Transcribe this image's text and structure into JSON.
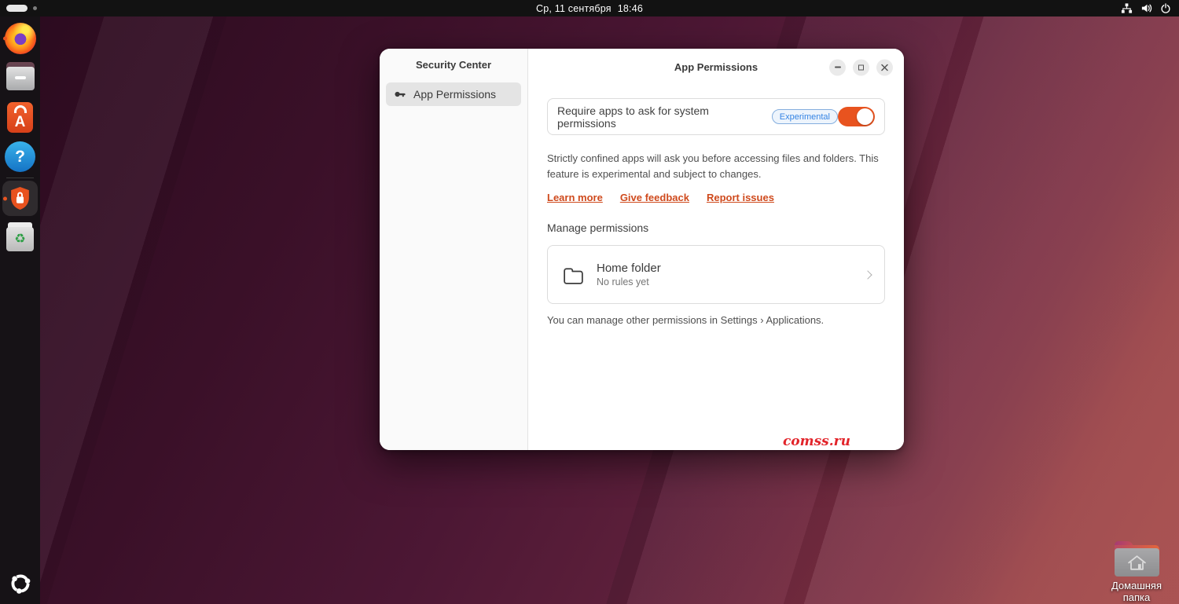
{
  "topbar": {
    "date": "Ср, 11 сентября",
    "time": "18:46",
    "status_icons": [
      "network-icon",
      "volume-icon",
      "power-icon"
    ],
    "workspace_indicator": "workspace-1-active"
  },
  "dock": {
    "items": [
      {
        "name": "firefox",
        "running": true
      },
      {
        "name": "files",
        "running": false
      },
      {
        "name": "app-center",
        "running": false
      },
      {
        "name": "help",
        "running": false
      },
      {
        "name": "security-center",
        "running": true,
        "focused": true
      },
      {
        "name": "trash",
        "running": false
      },
      {
        "name": "ubuntu-apps",
        "running": false
      }
    ],
    "app_center_glyph": "A",
    "help_glyph": "?",
    "trash_glyph": "♻"
  },
  "window": {
    "sidebar": {
      "title": "Security Center",
      "items": [
        {
          "label": "App Permissions",
          "icon": "key-icon",
          "selected": true
        }
      ]
    },
    "header": {
      "title": "App Permissions",
      "controls": [
        "minimize",
        "maximize",
        "close"
      ]
    },
    "toggle_row": {
      "label": "Require apps to ask for system permissions",
      "badge": "Experimental",
      "enabled": true
    },
    "description": "Strictly confined apps will ask you before accessing files and folders. This feature is experimental and subject to changes.",
    "links": [
      {
        "label": "Learn more"
      },
      {
        "label": "Give feedback"
      },
      {
        "label": "Report issues"
      }
    ],
    "manage_label": "Manage permissions",
    "home_card": {
      "icon": "folder-icon",
      "title": "Home folder",
      "subtitle": "No rules yet"
    },
    "footer": "You can manage other permissions in Settings › Applications.",
    "watermark": "comss.ru"
  },
  "desktop": {
    "home_icon_label": "Домашняя папка"
  },
  "colors": {
    "accent_orange": "#E8531F",
    "link_orange": "#CF4A1D",
    "badge_blue": "#3584E4",
    "watermark_red": "#E2242A",
    "topbar_bg": "#121212",
    "sidebar_bg": "#FAFAFA"
  }
}
